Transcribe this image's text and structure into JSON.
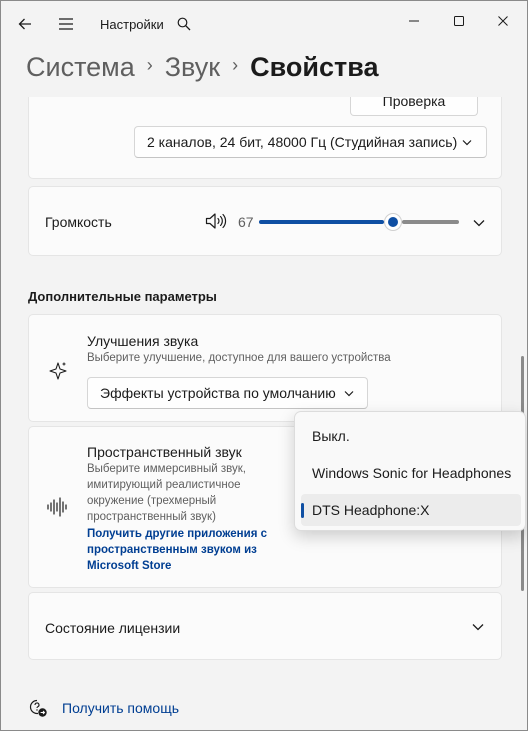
{
  "window": {
    "app_title": "Настройки"
  },
  "breadcrumb": {
    "items": [
      "Система",
      "Звук",
      "Свойства"
    ],
    "separator": "›"
  },
  "format": {
    "test_button": "Проверка",
    "selected": "2 каналов, 24 бит, 48000 Гц (Студийная запись)"
  },
  "volume": {
    "label": "Громкость",
    "value": "67",
    "fraction": 0.67
  },
  "advanced": {
    "heading": "Дополнительные параметры",
    "enhancements": {
      "title": "Улучшения звука",
      "description": "Выберите улучшение, доступное для вашего устройства",
      "selected": "Эффекты устройства по умолчанию"
    },
    "spatial": {
      "title": "Пространственный звук",
      "description_lines": [
        "Выберите иммерсивный звук,",
        "имитирующий реалистичное",
        "окружение (трехмерный",
        "пространственный звук)"
      ],
      "link_lines": [
        "Получить другие приложения с",
        "пространственным звуком из",
        "Microsoft Store"
      ],
      "options": [
        "Выкл.",
        "Windows Sonic for Headphones",
        "DTS Headphone:X"
      ],
      "selected_index": 2
    },
    "license": {
      "label": "Состояние лицензии"
    }
  },
  "help": {
    "label": "Получить помощь"
  },
  "colors": {
    "accent": "#0f4fa3",
    "link": "#003e92",
    "background": "#f3f3f3",
    "card": "#fbfbfb"
  }
}
